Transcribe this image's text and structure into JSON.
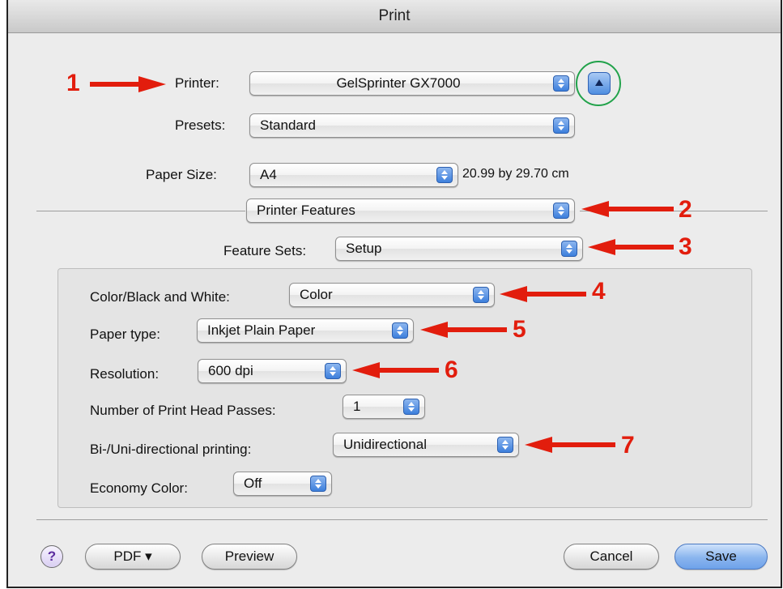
{
  "window": {
    "title": "Print"
  },
  "printer": {
    "label": "Printer:",
    "value": "GelSprinter GX7000"
  },
  "presets": {
    "label": "Presets:",
    "value": "Standard"
  },
  "paper_size": {
    "label": "Paper Size:",
    "value": "A4",
    "dimensions": "20.99 by 29.70 cm"
  },
  "section_popup": {
    "value": "Printer Features"
  },
  "feature_sets": {
    "label": "Feature Sets:",
    "value": "Setup"
  },
  "settings": {
    "color_bw": {
      "label": "Color/Black and White:",
      "value": "Color"
    },
    "paper_type": {
      "label": "Paper type:",
      "value": "Inkjet Plain Paper"
    },
    "resolution": {
      "label": "Resolution:",
      "value": "600 dpi"
    },
    "head_passes": {
      "label": "Number of Print Head Passes:",
      "value": "1"
    },
    "bidirectional": {
      "label": "Bi-/Uni-directional printing:",
      "value": "Unidirectional"
    },
    "economy": {
      "label": "Economy Color:",
      "value": "Off"
    }
  },
  "buttons": {
    "help": "?",
    "pdf": "PDF ▾",
    "preview": "Preview",
    "cancel": "Cancel",
    "save": "Save"
  },
  "annotations": {
    "n1": "1",
    "n2": "2",
    "n3": "3",
    "n4": "4",
    "n5": "5",
    "n6": "6",
    "n7": "7"
  },
  "colors": {
    "annotation_red": "#e21d0d",
    "highlight_green": "#21a24a",
    "stepper_blue": "#3d7fdc",
    "default_button_blue": "#8ab5ee"
  }
}
